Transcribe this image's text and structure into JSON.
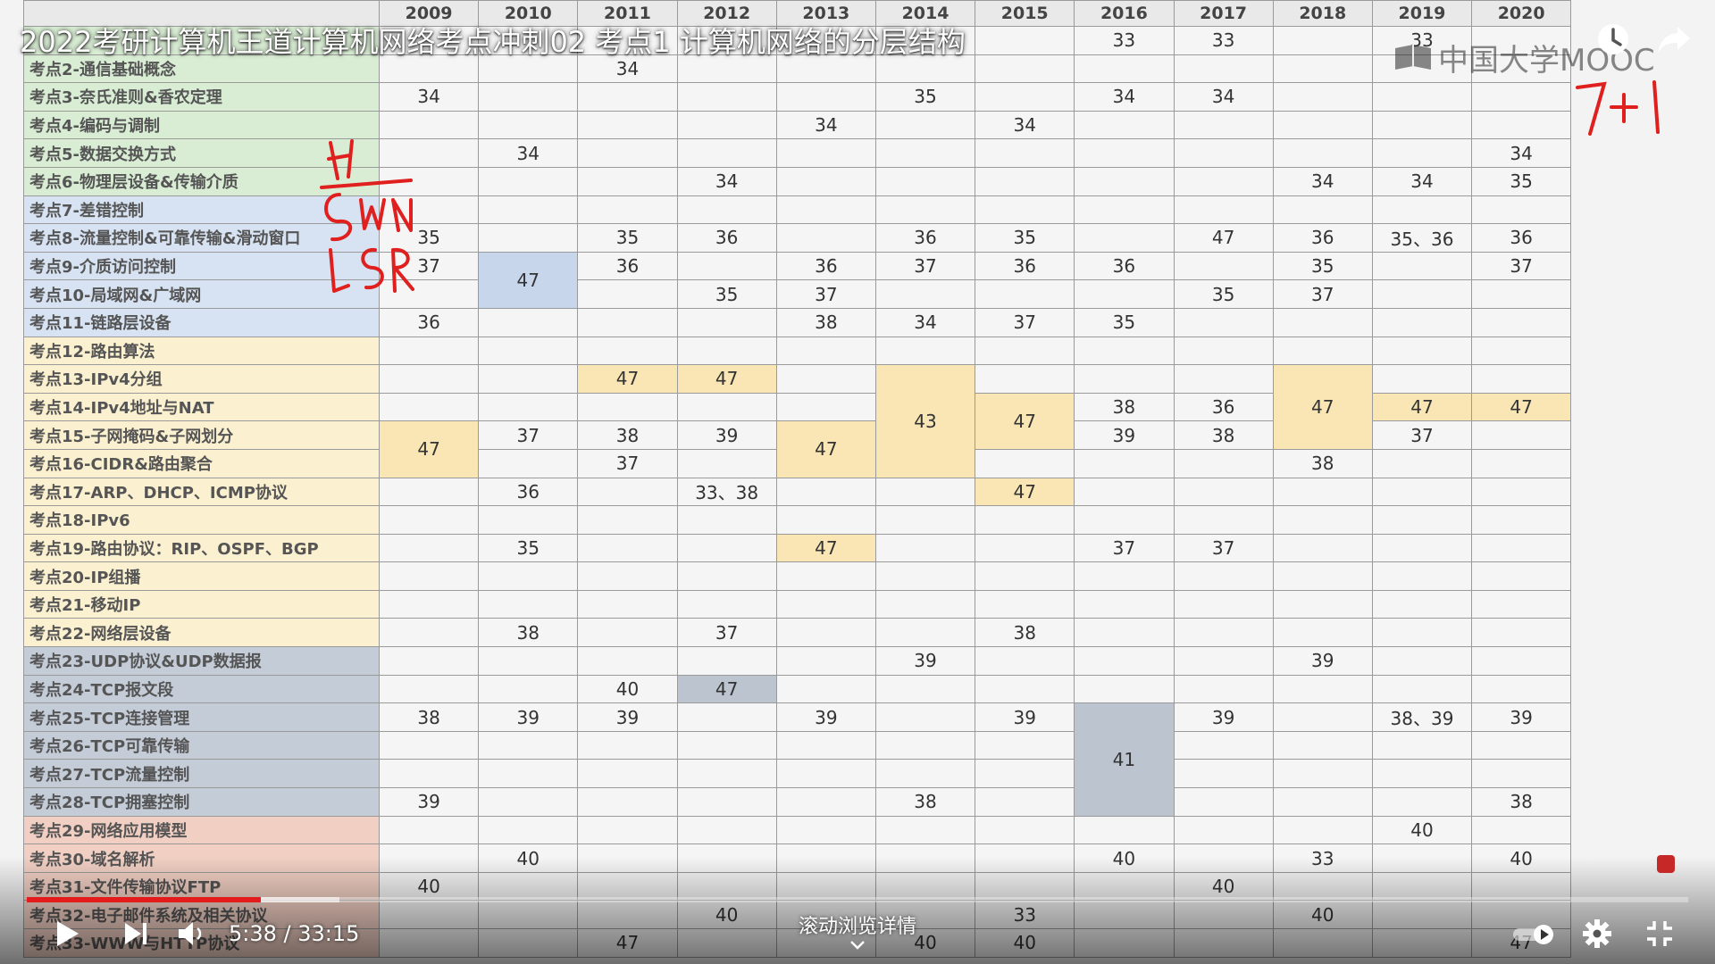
{
  "video": {
    "title": "2022考研计算机王道计算机网络考点冲刺02 考点1 计算机网络的分层结构",
    "watermark": "中国大学MOOC",
    "current_time": "5:38",
    "total_time": "33:15",
    "time_separator": " / ",
    "played_fraction": 0.141,
    "buffered_fraction": 0.188,
    "scroll_hint": "滚动浏览详情",
    "annotation_right": "7+1"
  },
  "colors": {
    "progress": "#e41b1b",
    "physical": "#d9edd4",
    "datalink": "#d7e3f2",
    "network": "#fbf0cf",
    "transport": "#c4ccd8",
    "application": "#f1cfc3",
    "highlight_yellow": "#f9e6b4",
    "highlight_blue": "#c8d6ec",
    "highlight_gray": "#bcc4d0"
  },
  "table": {
    "years": [
      "2009",
      "2010",
      "2011",
      "2012",
      "2013",
      "2014",
      "2015",
      "2016",
      "2017",
      "2018",
      "2019",
      "2020"
    ],
    "rows": [
      {
        "topic": "",
        "cells": [
          "",
          "",
          "",
          "",
          "",
          "",
          "",
          "33",
          "33",
          "",
          "33",
          ""
        ]
      },
      {
        "topic": "考点2-通信基础概念",
        "cells": [
          "",
          "",
          "34",
          "",
          "",
          "",
          "",
          "",
          "",
          "",
          "",
          ""
        ]
      },
      {
        "topic": "考点3-奈氏准则&香农定理",
        "cells": [
          "34",
          "",
          "",
          "",
          "",
          "35",
          "",
          "34",
          "34",
          "",
          "",
          ""
        ]
      },
      {
        "topic": "考点4-编码与调制",
        "cells": [
          "",
          "",
          "",
          "",
          "34",
          "",
          "34",
          "",
          "",
          "",
          "",
          ""
        ]
      },
      {
        "topic": "考点5-数据交换方式",
        "cells": [
          "",
          "34",
          "",
          "",
          "",
          "",
          "",
          "",
          "",
          "",
          "",
          "34"
        ]
      },
      {
        "topic": "考点6-物理层设备&传输介质",
        "cells": [
          "",
          "",
          "",
          "34",
          "",
          "",
          "",
          "",
          "",
          "34",
          "34",
          "35"
        ]
      },
      {
        "topic": "考点7-差错控制",
        "cells": [
          "",
          "",
          "",
          "",
          "",
          "",
          "",
          "",
          "",
          "",
          "",
          ""
        ]
      },
      {
        "topic": "考点8-流量控制&可靠传输&滑动窗口",
        "cells": [
          "35",
          "",
          "35",
          "36",
          "",
          "36",
          "35",
          "",
          "47",
          "36",
          "35、36",
          "36"
        ]
      },
      {
        "topic": "考点9-介质访问控制",
        "cells": [
          "37",
          "47",
          "36",
          "",
          "36",
          "37",
          "36",
          "36",
          "",
          "35",
          "",
          "37"
        ]
      },
      {
        "topic": "考点10-局域网&广域网",
        "cells": [
          "",
          "",
          "",
          "35",
          "37",
          "",
          "",
          "",
          "35",
          "37",
          "",
          ""
        ]
      },
      {
        "topic": "考点11-链路层设备",
        "cells": [
          "36",
          "",
          "",
          "",
          "38",
          "34",
          "37",
          "35",
          "",
          "",
          "",
          ""
        ]
      },
      {
        "topic": "考点12-路由算法",
        "cells": [
          "",
          "",
          "",
          "",
          "",
          "",
          "",
          "",
          "",
          "",
          "",
          ""
        ]
      },
      {
        "topic": "考点13-IPv4分组",
        "cells": [
          "",
          "",
          "47",
          "47",
          "",
          "43",
          "",
          "",
          "",
          "47",
          "",
          ""
        ]
      },
      {
        "topic": "考点14-IPv4地址与NAT",
        "cells": [
          "",
          "",
          "",
          "",
          "",
          "",
          "47",
          "38",
          "36",
          "",
          "47",
          "47"
        ]
      },
      {
        "topic": "考点15-子网掩码&子网划分",
        "cells": [
          "47",
          "37",
          "38",
          "39",
          "47",
          "",
          "",
          "39",
          "38",
          "",
          "37",
          ""
        ]
      },
      {
        "topic": "考点16-CIDR&路由聚合",
        "cells": [
          "",
          "",
          "37",
          "",
          "",
          "",
          "",
          "",
          "",
          "38",
          "",
          ""
        ]
      },
      {
        "topic": "考点17-ARP、DHCP、ICMP协议",
        "cells": [
          "",
          "36",
          "",
          "33、38",
          "",
          "",
          "47",
          "",
          "",
          "",
          "",
          ""
        ]
      },
      {
        "topic": "考点18-IPv6",
        "cells": [
          "",
          "",
          "",
          "",
          "",
          "",
          "",
          "",
          "",
          "",
          "",
          ""
        ]
      },
      {
        "topic": "考点19-路由协议：RIP、OSPF、BGP",
        "cells": [
          "",
          "35",
          "",
          "",
          "47",
          "",
          "",
          "37",
          "37",
          "",
          "",
          ""
        ]
      },
      {
        "topic": "考点20-IP组播",
        "cells": [
          "",
          "",
          "",
          "",
          "",
          "",
          "",
          "",
          "",
          "",
          "",
          ""
        ]
      },
      {
        "topic": "考点21-移动IP",
        "cells": [
          "",
          "",
          "",
          "",
          "",
          "",
          "",
          "",
          "",
          "",
          "",
          ""
        ]
      },
      {
        "topic": "考点22-网络层设备",
        "cells": [
          "",
          "38",
          "",
          "37",
          "",
          "",
          "38",
          "",
          "",
          "",
          "",
          ""
        ]
      },
      {
        "topic": "考点23-UDP协议&UDP数据报",
        "cells": [
          "",
          "",
          "",
          "",
          "",
          "39",
          "",
          "",
          "",
          "39",
          "",
          ""
        ]
      },
      {
        "topic": "考点24-TCP报文段",
        "cells": [
          "",
          "",
          "40",
          "47",
          "",
          "",
          "",
          "",
          "",
          "",
          "",
          ""
        ]
      },
      {
        "topic": "考点25-TCP连接管理",
        "cells": [
          "38",
          "39",
          "39",
          "",
          "39",
          "",
          "39",
          "41",
          "39",
          "",
          "38、39",
          "39"
        ]
      },
      {
        "topic": "考点26-TCP可靠传输",
        "cells": [
          "",
          "",
          "",
          "",
          "",
          "",
          "",
          "",
          "",
          "",
          "",
          ""
        ]
      },
      {
        "topic": "考点27-TCP流量控制",
        "cells": [
          "",
          "",
          "",
          "",
          "",
          "",
          "",
          "",
          "",
          "",
          "",
          ""
        ]
      },
      {
        "topic": "考点28-TCP拥塞控制",
        "cells": [
          "39",
          "",
          "",
          "",
          "",
          "38",
          "",
          "",
          "",
          "",
          "",
          "38"
        ]
      },
      {
        "topic": "考点29-网络应用模型",
        "cells": [
          "",
          "",
          "",
          "",
          "",
          "",
          "",
          "",
          "",
          "",
          "40",
          ""
        ]
      },
      {
        "topic": "考点30-域名解析",
        "cells": [
          "",
          "40",
          "",
          "",
          "",
          "",
          "",
          "40",
          "",
          "33",
          "",
          "40"
        ]
      },
      {
        "topic": "考点31-文件传输协议FTP",
        "cells": [
          "40",
          "",
          "",
          "",
          "",
          "",
          "",
          "",
          "40",
          "",
          "",
          ""
        ]
      },
      {
        "topic": "考点32-电子邮件系统及相关协议",
        "cells": [
          "",
          "",
          "",
          "40",
          "",
          "",
          "33",
          "",
          "",
          "40",
          "",
          ""
        ]
      },
      {
        "topic": "考点33-WWW与HTTP协议",
        "cells": [
          "",
          "",
          "47",
          "",
          "",
          "40",
          "40",
          "",
          "",
          "",
          "",
          "47"
        ]
      }
    ]
  }
}
